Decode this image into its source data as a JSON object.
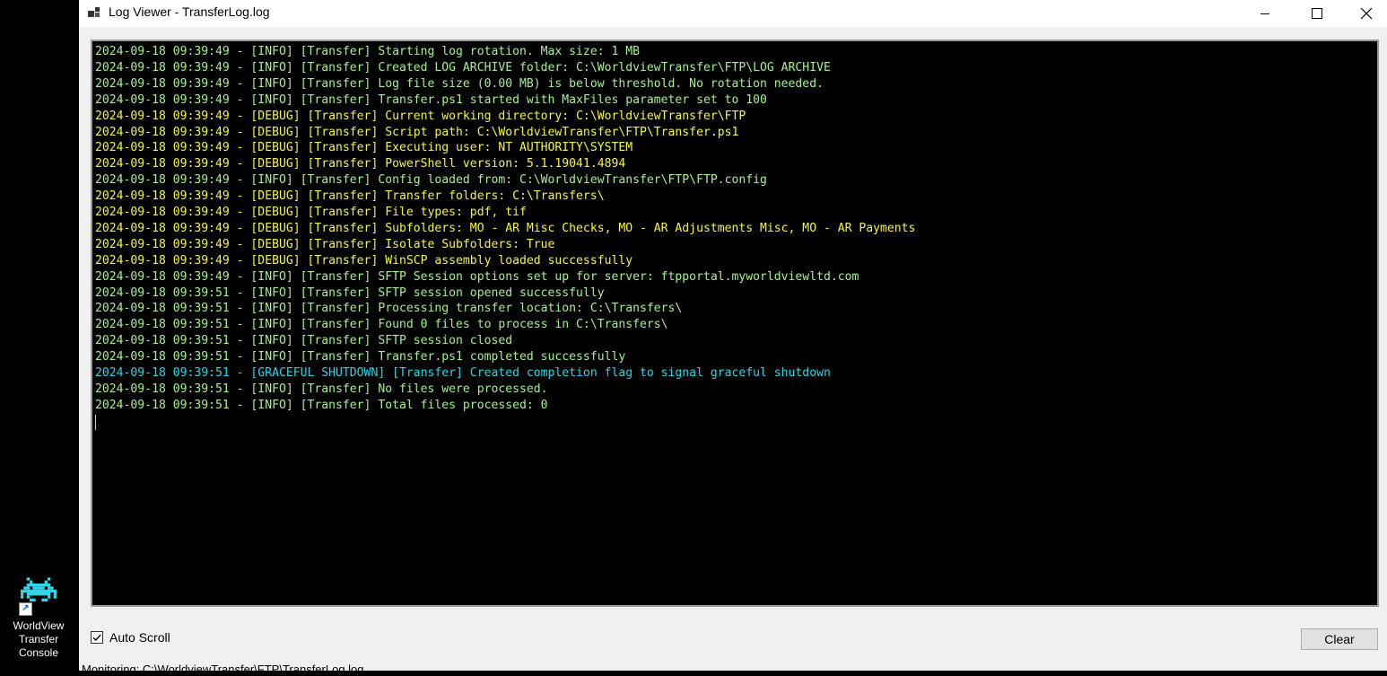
{
  "desktop": {
    "shortcut_label": "WorldView Transfer Console",
    "shortcut_icon": "space-invader-icon"
  },
  "window": {
    "title": "Log Viewer - TransferLog.log",
    "controls": [
      "minimize-icon",
      "maximize-icon",
      "close-icon"
    ]
  },
  "colors": {
    "info": "#a6f08f",
    "debug": "#f5f542",
    "graceful": "#2ed3e6",
    "log_bg": "#000000"
  },
  "log": {
    "lines": [
      {
        "level": "info",
        "text": "2024-09-18 09:39:49 - [INFO] [Transfer] Starting log rotation. Max size: 1 MB"
      },
      {
        "level": "info",
        "text": "2024-09-18 09:39:49 - [INFO] [Transfer] Created LOG ARCHIVE folder: C:\\WorldviewTransfer\\FTP\\LOG ARCHIVE"
      },
      {
        "level": "info",
        "text": "2024-09-18 09:39:49 - [INFO] [Transfer] Log file size (0.00 MB) is below threshold. No rotation needed."
      },
      {
        "level": "info",
        "text": "2024-09-18 09:39:49 - [INFO] [Transfer] Transfer.ps1 started with MaxFiles parameter set to 100"
      },
      {
        "level": "debug",
        "text": "2024-09-18 09:39:49 - [DEBUG] [Transfer] Current working directory: C:\\WorldviewTransfer\\FTP"
      },
      {
        "level": "debug",
        "text": "2024-09-18 09:39:49 - [DEBUG] [Transfer] Script path: C:\\WorldviewTransfer\\FTP\\Transfer.ps1"
      },
      {
        "level": "debug",
        "text": "2024-09-18 09:39:49 - [DEBUG] [Transfer] Executing user: NT AUTHORITY\\SYSTEM"
      },
      {
        "level": "debug",
        "text": "2024-09-18 09:39:49 - [DEBUG] [Transfer] PowerShell version: 5.1.19041.4894"
      },
      {
        "level": "info",
        "text": "2024-09-18 09:39:49 - [INFO] [Transfer] Config loaded from: C:\\WorldviewTransfer\\FTP\\FTP.config"
      },
      {
        "level": "debug",
        "text": "2024-09-18 09:39:49 - [DEBUG] [Transfer] Transfer folders: C:\\Transfers\\"
      },
      {
        "level": "debug",
        "text": "2024-09-18 09:39:49 - [DEBUG] [Transfer] File types: pdf, tif"
      },
      {
        "level": "debug",
        "text": "2024-09-18 09:39:49 - [DEBUG] [Transfer] Subfolders: MO - AR Misc Checks, MO - AR Adjustments Misc, MO - AR Payments"
      },
      {
        "level": "debug",
        "text": "2024-09-18 09:39:49 - [DEBUG] [Transfer] Isolate Subfolders: True"
      },
      {
        "level": "debug",
        "text": "2024-09-18 09:39:49 - [DEBUG] [Transfer] WinSCP assembly loaded successfully"
      },
      {
        "level": "info",
        "text": "2024-09-18 09:39:49 - [INFO] [Transfer] SFTP Session options set up for server: ftpportal.myworldviewltd.com"
      },
      {
        "level": "info",
        "text": "2024-09-18 09:39:51 - [INFO] [Transfer] SFTP session opened successfully"
      },
      {
        "level": "info",
        "text": "2024-09-18 09:39:51 - [INFO] [Transfer] Processing transfer location: C:\\Transfers\\"
      },
      {
        "level": "info",
        "text": "2024-09-18 09:39:51 - [INFO] [Transfer] Found 0 files to process in C:\\Transfers\\"
      },
      {
        "level": "info",
        "text": "2024-09-18 09:39:51 - [INFO] [Transfer] SFTP session closed"
      },
      {
        "level": "info",
        "text": "2024-09-18 09:39:51 - [INFO] [Transfer] Transfer.ps1 completed successfully"
      },
      {
        "level": "graceful",
        "text": "2024-09-18 09:39:51 - [GRACEFUL SHUTDOWN] [Transfer] Created completion flag to signal graceful shutdown"
      },
      {
        "level": "info",
        "text": "2024-09-18 09:39:51 - [INFO] [Transfer] No files were processed."
      },
      {
        "level": "info",
        "text": "2024-09-18 09:39:51 - [INFO] [Transfer] Total files processed: 0"
      }
    ]
  },
  "controls": {
    "auto_scroll_label": "Auto Scroll",
    "auto_scroll_checked": true,
    "clear_label": "Clear"
  },
  "status": {
    "text": "Monitoring: C:\\WorldviewTransfer\\FTP\\TransferLog.log"
  }
}
